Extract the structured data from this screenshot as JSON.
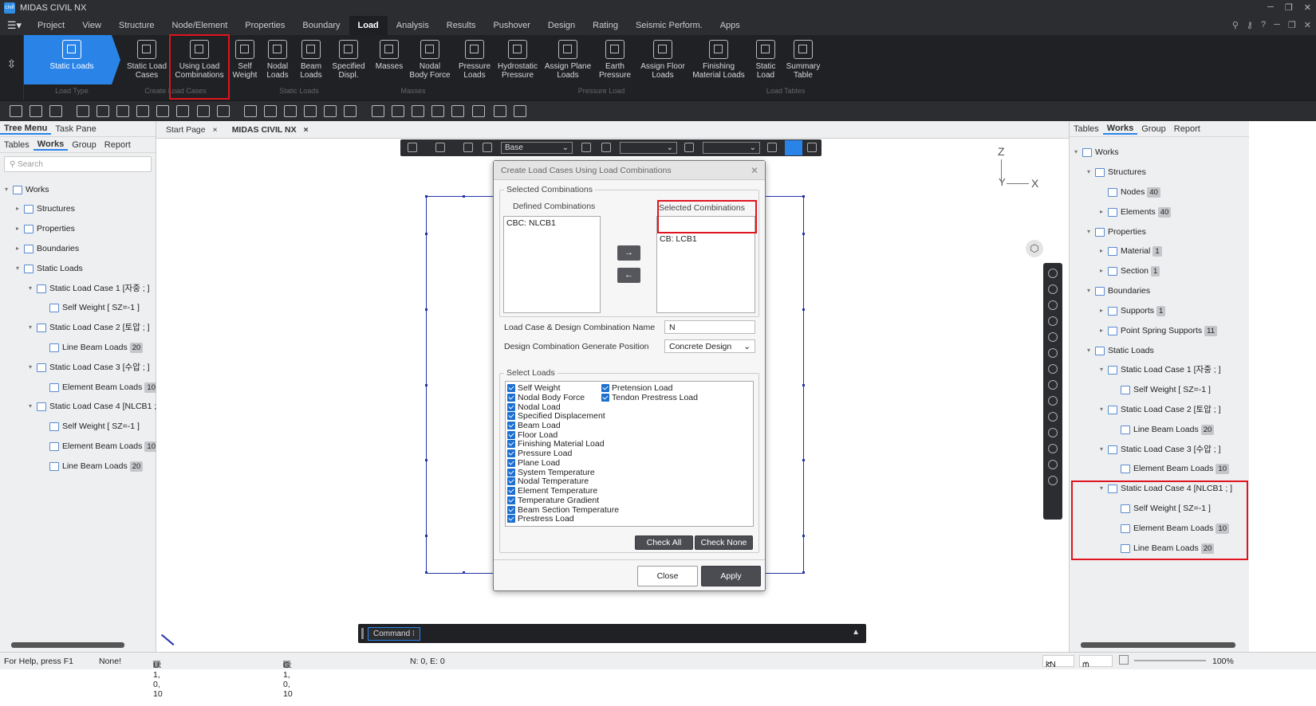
{
  "app_title": "MIDAS CIVIL NX",
  "logo_text": "civil",
  "menu": [
    "Project",
    "View",
    "Structure",
    "Node/Element",
    "Properties",
    "Boundary",
    "Load",
    "Analysis",
    "Results",
    "Pushover",
    "Design",
    "Rating",
    "Seismic Perform.",
    "Apps"
  ],
  "active_menu": "Load",
  "ribbon": {
    "static_loads": "Static Loads",
    "buttons": [
      {
        "l1": "Static Load",
        "l2": "Cases"
      },
      {
        "l1": "Using Load",
        "l2": "Combinations"
      },
      {
        "l1": "Self",
        "l2": "Weight"
      },
      {
        "l1": "Nodal",
        "l2": "Loads"
      },
      {
        "l1": "Beam",
        "l2": "Loads"
      },
      {
        "l1": "Specified",
        "l2": "Displ."
      },
      {
        "l1": "Masses",
        "l2": ""
      },
      {
        "l1": "Nodal",
        "l2": "Body Force"
      },
      {
        "l1": "Pressure",
        "l2": "Loads"
      },
      {
        "l1": "Hydrostatic",
        "l2": "Pressure"
      },
      {
        "l1": "Assign Plane",
        "l2": "Loads"
      },
      {
        "l1": "Earth",
        "l2": "Pressure"
      },
      {
        "l1": "Assign Floor",
        "l2": "Loads"
      },
      {
        "l1": "Finishing",
        "l2": "Material Loads"
      },
      {
        "l1": "Static",
        "l2": "Load"
      },
      {
        "l1": "Summary",
        "l2": "Table"
      }
    ],
    "groups": [
      "Load Type",
      "Create Load Cases",
      "Static Loads",
      "Masses",
      "Pressure Load",
      "Load Tables"
    ]
  },
  "left_panel": {
    "top_tabs": [
      "Tree Menu",
      "Task Pane"
    ],
    "tabs": [
      "Tables",
      "Works",
      "Group",
      "Report"
    ],
    "search_placeholder": "Search",
    "tree": [
      {
        "label": "Works",
        "badge": ""
      },
      {
        "label": "Structures",
        "badge": ""
      },
      {
        "label": "Properties",
        "badge": ""
      },
      {
        "label": "Boundaries",
        "badge": ""
      },
      {
        "label": "Static Loads",
        "badge": ""
      },
      {
        "label": "Static Load Case 1 [자중 ; ]",
        "badge": ""
      },
      {
        "label": "Self Weight [ SZ=-1 ]",
        "badge": ""
      },
      {
        "label": "Static Load Case 2 [토압 ; ]",
        "badge": ""
      },
      {
        "label": "Line Beam Loads",
        "badge": "20"
      },
      {
        "label": "Static Load Case 3 [수압 ; ]",
        "badge": ""
      },
      {
        "label": "Element Beam Loads",
        "badge": "10"
      },
      {
        "label": "Static Load Case 4 [NLCB1 ; ]",
        "badge": ""
      },
      {
        "label": "Self Weight [ SZ=-1 ]",
        "badge": ""
      },
      {
        "label": "Element Beam Loads",
        "badge": "10"
      },
      {
        "label": "Line Beam Loads",
        "badge": "20"
      }
    ]
  },
  "doc_tabs": [
    "Start Page",
    "MIDAS CIVIL NX"
  ],
  "view_toolbar": {
    "base": "Base"
  },
  "axes": {
    "z": "Z",
    "y": "Y",
    "x": "X"
  },
  "dialog": {
    "title": "Create Load Cases Using Load Combinations",
    "selected_combinations_group": "Selected Combinations",
    "defined_label": "Defined Combinations",
    "defined_items": [
      "CBC: NLCB1"
    ],
    "selected_label": "Selected Combinations",
    "selected_items": [
      "CB: LCB1"
    ],
    "name_label": "Load Case & Design Combination Name",
    "name_value": "N",
    "position_label": "Design Combination Generate Position",
    "position_value": "Concrete Design",
    "select_loads_group": "Select Loads",
    "loads_col1": [
      "Self Weight",
      "Nodal Body Force",
      "Nodal Load",
      "Specified Displacement",
      "Beam Load",
      "Floor Load",
      "Finishing Material Load",
      "Pressure Load",
      "Plane Load",
      "System Temperature",
      "Nodal Temperature",
      "Element Temperature",
      "Temperature Gradient",
      "Beam Section Temperature",
      "Prestress Load"
    ],
    "loads_col2": [
      "Pretension Load",
      "Tendon Prestress Load"
    ],
    "check_all": "Check All",
    "check_none": "Check None",
    "close": "Close",
    "apply": "Apply"
  },
  "command": {
    "label": "Command"
  },
  "right_panel": {
    "tabs": [
      "Tables",
      "Works",
      "Group",
      "Report"
    ],
    "tree": [
      {
        "label": "Works",
        "badge": ""
      },
      {
        "label": "Structures",
        "badge": ""
      },
      {
        "label": "Nodes",
        "badge": "40"
      },
      {
        "label": "Elements",
        "badge": "40"
      },
      {
        "label": "Properties",
        "badge": ""
      },
      {
        "label": "Material",
        "badge": "1"
      },
      {
        "label": "Section",
        "badge": "1"
      },
      {
        "label": "Boundaries",
        "badge": ""
      },
      {
        "label": "Supports",
        "badge": "1"
      },
      {
        "label": "Point Spring Supports",
        "badge": "11"
      },
      {
        "label": "Static Loads",
        "badge": ""
      },
      {
        "label": "Static Load Case 1 [자중 ; ]",
        "badge": ""
      },
      {
        "label": "Self Weight [ SZ=-1 ]",
        "badge": ""
      },
      {
        "label": "Static Load Case 2 [토압 ; ]",
        "badge": ""
      },
      {
        "label": "Line Beam Loads",
        "badge": "20"
      },
      {
        "label": "Static Load Case 3 [수압 ; ]",
        "badge": ""
      },
      {
        "label": "Element Beam Loads",
        "badge": "10"
      },
      {
        "label": "Static Load Case 4 [NLCB1 ; ]",
        "badge": ""
      },
      {
        "label": "Self Weight [ SZ=-1 ]",
        "badge": ""
      },
      {
        "label": "Element Beam Loads",
        "badge": "10"
      },
      {
        "label": "Line Beam Loads",
        "badge": "20"
      }
    ]
  },
  "status": {
    "help": "For Help, press F1",
    "none": "None!",
    "u": "U: 1, 0, 10",
    "g": "G: 1, 0, 10",
    "n": "N: 0, E: 0",
    "force_unit": "kN",
    "length_unit": "m",
    "zoom": "100%"
  },
  "colors": {
    "accent": "#2a84e8",
    "highlight": "#e0141e",
    "dark": "#2b2d31"
  }
}
